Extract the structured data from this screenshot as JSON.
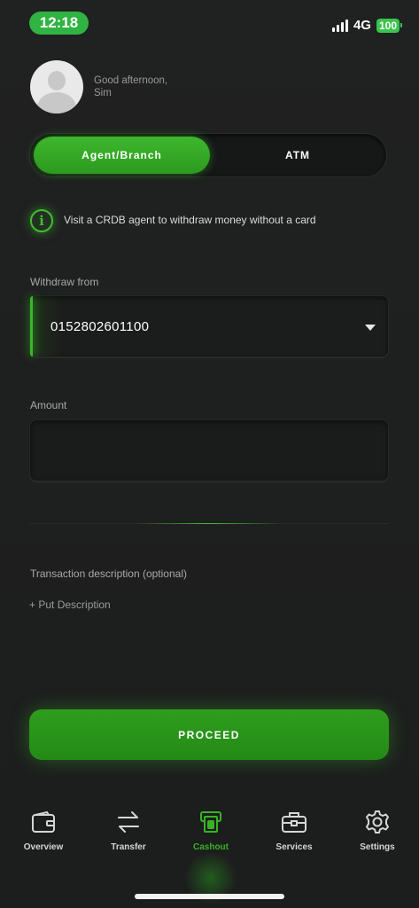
{
  "status_bar": {
    "time": "12:18",
    "network": "4G",
    "battery": "100"
  },
  "greeting": {
    "line1": "Good afternoon,",
    "line2": "Sim"
  },
  "toggle": {
    "active": "Agent/Branch",
    "inactive": "ATM"
  },
  "info": {
    "text": "Visit a CRDB agent to withdraw money without a card"
  },
  "withdraw": {
    "label": "Withdraw from",
    "value": "0152802601100"
  },
  "amount": {
    "label": "Amount",
    "value": ""
  },
  "description": {
    "label": "Transaction description (optional)",
    "add": "+ Put Description"
  },
  "proceed": {
    "label": "PROCEED"
  },
  "nav": {
    "items": [
      {
        "label": "Overview",
        "icon": "wallet-icon"
      },
      {
        "label": "Transfer",
        "icon": "transfer-icon"
      },
      {
        "label": "Cashout",
        "icon": "cashout-icon",
        "active": true
      },
      {
        "label": "Services",
        "icon": "briefcase-icon"
      },
      {
        "label": "Settings",
        "icon": "gear-icon"
      }
    ]
  },
  "colors": {
    "accent": "#36b424",
    "background": "#1d1e1e"
  }
}
